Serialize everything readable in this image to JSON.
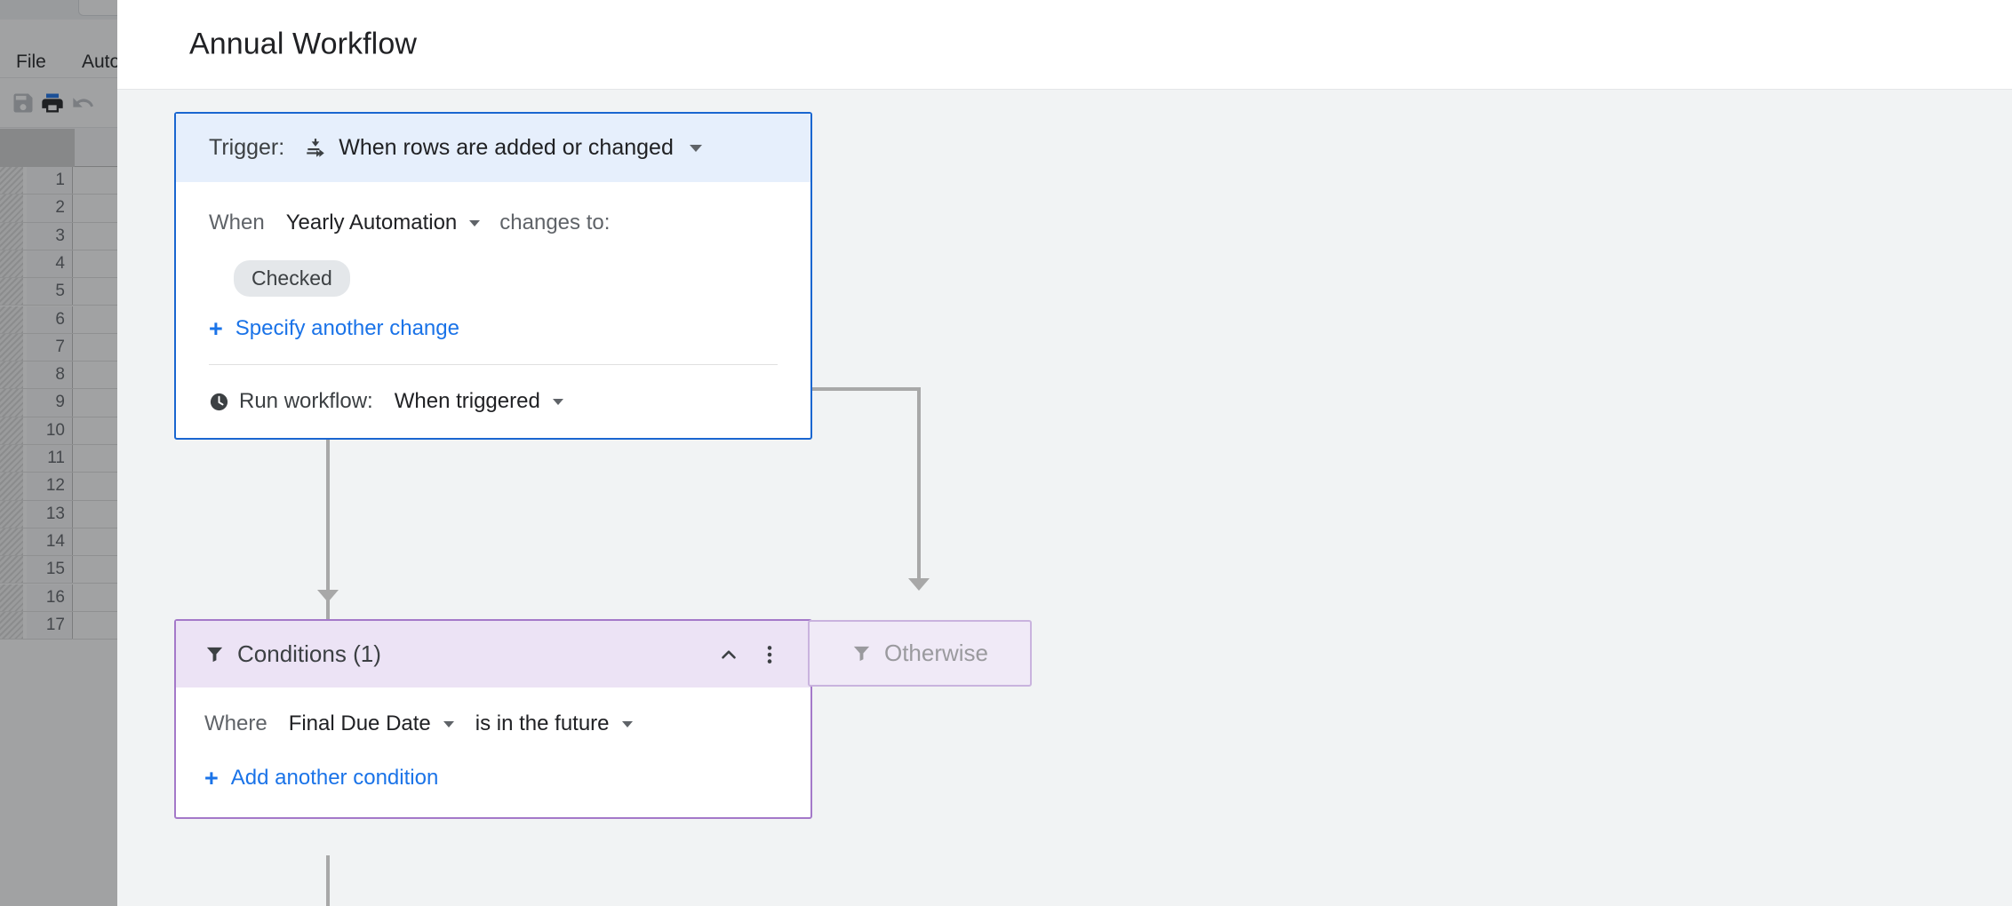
{
  "background": {
    "app": "google-sheets",
    "menus": [
      {
        "label": "File"
      },
      {
        "label": "Auto"
      }
    ],
    "toolbar_icons": [
      "save-icon",
      "print-icon",
      "undo-icon"
    ],
    "row_numbers": [
      "1",
      "2",
      "3",
      "4",
      "5",
      "6",
      "7",
      "8",
      "9",
      "10",
      "11",
      "12",
      "13",
      "14",
      "15",
      "16",
      "17"
    ]
  },
  "dialog": {
    "title": "Annual Workflow",
    "trigger": {
      "label": "Trigger:",
      "icon": "rows-added-or-changed-icon",
      "value": "When rows are added or changed",
      "when_label": "When",
      "column_value": "Yearly Automation",
      "changes_to_label": "changes to:",
      "chip_value": "Checked",
      "add_change_link": "Specify another change",
      "run_workflow_label": "Run workflow:",
      "run_workflow_value": "When triggered",
      "run_workflow_icon": "clock-icon"
    },
    "add_step_button": "+",
    "conditions": {
      "icon": "filter-funnel-icon",
      "title": "Conditions (1)",
      "collapse_icon": "chevron-up-icon",
      "menu_icon": "more-vertical-icon",
      "where_label": "Where",
      "field_value": "Final Due Date",
      "operator_value": "is in the future",
      "add_condition_link": "Add another condition"
    },
    "otherwise": {
      "icon": "filter-funnel-icon",
      "label": "Otherwise"
    }
  },
  "colors": {
    "accent_blue": "#1a73e8",
    "trigger_border": "#1a66d0",
    "trigger_header_bg": "#e6effc",
    "condition_border": "#a479c9",
    "condition_header_bg": "#ece3f5",
    "otherwise_bg": "#f0eaf7",
    "canvas_bg": "#f1f3f4",
    "connector": "#a8a8a8"
  }
}
